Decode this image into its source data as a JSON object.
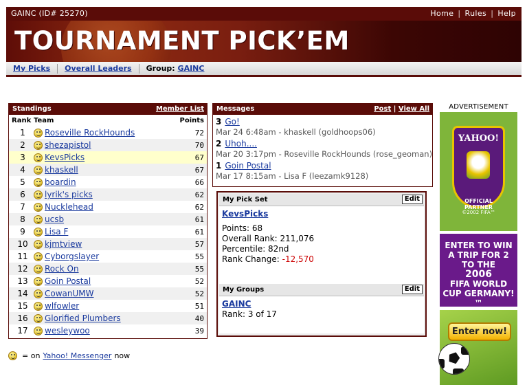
{
  "topbar": {
    "id_text": "GAINC (ID# 25270)",
    "links": [
      "Home",
      "Rules",
      "Help"
    ],
    "separator": "|"
  },
  "banner": {
    "title": "TOURNAMENT PICK’EM"
  },
  "nav": {
    "my_picks": "My Picks",
    "overall_leaders": "Overall Leaders",
    "group_label": "Group:",
    "group_name": "GAINC"
  },
  "standings": {
    "title": "Standings",
    "member_list": "Member List",
    "col_rank": "Rank",
    "col_team": "Team",
    "col_points": "Points",
    "rows": [
      {
        "rank": "1",
        "team": "Roseville RockHounds",
        "points": "72"
      },
      {
        "rank": "2",
        "team": "shezapistol",
        "points": "70"
      },
      {
        "rank": "3",
        "team": "KevsPicks",
        "points": "67"
      },
      {
        "rank": "4",
        "team": "khaskell",
        "points": "67"
      },
      {
        "rank": "5",
        "team": "boardin",
        "points": "66"
      },
      {
        "rank": "6",
        "team": "lyrik's picks",
        "points": "62"
      },
      {
        "rank": "7",
        "team": "Nucklehead",
        "points": "62"
      },
      {
        "rank": "8",
        "team": "ucsb",
        "points": "61"
      },
      {
        "rank": "9",
        "team": "Lisa F",
        "points": "61"
      },
      {
        "rank": "10",
        "team": "kjmtview",
        "points": "57"
      },
      {
        "rank": "11",
        "team": "Cyborgslayer",
        "points": "55"
      },
      {
        "rank": "12",
        "team": "Rock On",
        "points": "55"
      },
      {
        "rank": "13",
        "team": "Goin Postal",
        "points": "52"
      },
      {
        "rank": "14",
        "team": "CowanUMW",
        "points": "52"
      },
      {
        "rank": "15",
        "team": "wlfowler",
        "points": "51"
      },
      {
        "rank": "16",
        "team": "Glorified Plumbers",
        "points": "40"
      },
      {
        "rank": "17",
        "team": "wesleywoo",
        "points": "39"
      }
    ]
  },
  "messages": {
    "title": "Messages",
    "post": "Post",
    "view_all": "View All",
    "sep": "|",
    "items": [
      {
        "num": "3",
        "subject": "Go!",
        "meta": "Mar 24 6:48am - khaskell (goldhoops06)"
      },
      {
        "num": "2",
        "subject": "Uhoh....",
        "meta": "Mar 20 3:17pm - Roseville RockHounds (rose_geoman)"
      },
      {
        "num": "1",
        "subject": "Goin Postal",
        "meta": "Mar 17 8:15am - Lisa F (leezamk9128)"
      }
    ]
  },
  "pickset": {
    "title": "My Pick Set",
    "edit": "Edit",
    "name": "KevsPicks",
    "points": "Points: 68",
    "overall_rank": "Overall Rank: 211,076",
    "percentile": "Percentile: 82nd",
    "rank_change_label": "Rank Change:",
    "rank_change_value": "-12,570"
  },
  "groups": {
    "title": "My Groups",
    "edit": "Edit",
    "name": "GAINC",
    "rank": "Rank: 3 of 17"
  },
  "ads": {
    "label": "ADVERTISEMENT",
    "yahoo": "YAHOO!",
    "official": "OFFICIAL PARTNER",
    "fifa": "©2002 FIFA™",
    "promo": [
      "ENTER TO WIN",
      "A TRIP FOR 2",
      "TO THE",
      "2006",
      "FIFA WORLD",
      "CUP GERMANY!™"
    ],
    "enter_now": "Enter now!"
  },
  "legend": {
    "eq": "= on",
    "link": "Yahoo! Messenger",
    "now": "now"
  },
  "colors": {
    "accent": "#5a0c08",
    "link": "#1a3a9e",
    "highlight": "#ffffcc",
    "negative": "#cc0000"
  }
}
